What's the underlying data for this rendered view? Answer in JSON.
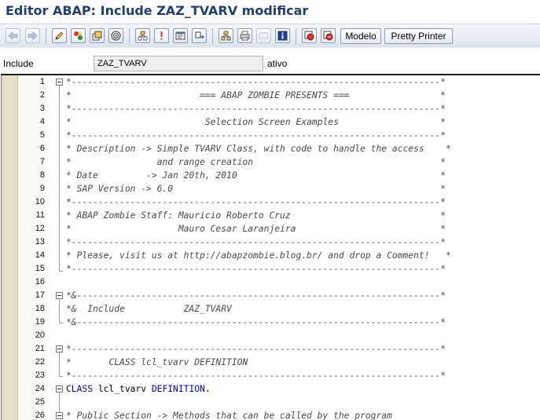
{
  "window": {
    "title": "Editor ABAP: Include ZAZ_TVARV modificar"
  },
  "toolbar": {
    "icons": [
      "back-arrow-icon",
      "forward-arrow-icon",
      "edit-pencil-icon",
      "toggle-display-icon",
      "other-object-icon",
      "activate-icon",
      "where-used-icon",
      "navigate-icon",
      "display-object-list-icon",
      "enhancement-icon",
      "pattern-icon",
      "pretty-printer-icon",
      "disabled-icon",
      "info-icon",
      "breakpoint-icon",
      "session-breakpoint-icon"
    ],
    "modelo_label": "Modelo",
    "pretty_printer_label": "Pretty Printer"
  },
  "info": {
    "include_label": "Include",
    "include_value": "ZAZ_TVARV",
    "status": "ativo"
  },
  "colors": {
    "title": "#1f3f73",
    "keyword": "#0000cc",
    "comment": "#4a4a4a"
  },
  "editor": {
    "lines": [
      {
        "num": "1",
        "kind": "comment",
        "text": "*---------------------------------------------------------------------*"
      },
      {
        "num": "2",
        "kind": "comment",
        "text": "*                        === ABAP ZOMBIE PRESENTS ===                 *"
      },
      {
        "num": "3",
        "kind": "comment",
        "text": "*---------------------------------------------------------------------*"
      },
      {
        "num": "4",
        "kind": "comment",
        "text": "*                         Selection Screen Examples                   *"
      },
      {
        "num": "5",
        "kind": "comment",
        "text": "*---------------------------------------------------------------------*"
      },
      {
        "num": "6",
        "kind": "comment",
        "text": "* Description -> Simple TVARV Class, with code to handle the access    *"
      },
      {
        "num": "7",
        "kind": "comment",
        "text": "*                and range creation                                   *"
      },
      {
        "num": "8",
        "kind": "comment",
        "text": "* Date         -> Jan 20th, 2010                                      *"
      },
      {
        "num": "9",
        "kind": "comment",
        "text": "* SAP Version -> 6.0                                                  *"
      },
      {
        "num": "10",
        "kind": "comment",
        "text": "*---------------------------------------------------------------------*"
      },
      {
        "num": "11",
        "kind": "comment",
        "text": "* ABAP Zombie Staff: Mauricio Roberto Cruz                            *"
      },
      {
        "num": "12",
        "kind": "comment",
        "text": "*                    Mauro Cesar Laranjeira                           *"
      },
      {
        "num": "13",
        "kind": "comment",
        "text": "*---------------------------------------------------------------------*"
      },
      {
        "num": "14",
        "kind": "comment",
        "text": "* Please, visit us at http://abapzombie.blog.br/ and drop a Comment!   *"
      },
      {
        "num": "15",
        "kind": "comment",
        "text": "*---------------------------------------------------------------------*"
      },
      {
        "num": "16",
        "kind": "blank",
        "text": ""
      },
      {
        "num": "17",
        "kind": "comment",
        "text": "*&--------------------------------------------------------------------*"
      },
      {
        "num": "18",
        "kind": "comment",
        "text": "*&  Include           ZAZ_TVARV"
      },
      {
        "num": "19",
        "kind": "comment",
        "text": "*&--------------------------------------------------------------------*"
      },
      {
        "num": "20",
        "kind": "blank",
        "text": ""
      },
      {
        "num": "21",
        "kind": "comment",
        "text": "*---------------------------------------------------------------------*"
      },
      {
        "num": "22",
        "kind": "comment",
        "text": "*       CLASS lcl_tvarv DEFINITION"
      },
      {
        "num": "23",
        "kind": "comment",
        "text": "*---------------------------------------------------------------------*"
      },
      {
        "num": "24",
        "kind": "stmt",
        "text": "",
        "parts": [
          "CLASS",
          " lcl_tvarv ",
          "DEFINITION."
        ]
      },
      {
        "num": "25",
        "kind": "blank",
        "text": ""
      },
      {
        "num": "26",
        "kind": "comment",
        "text": "* Public Section -> Methods that can be called by the program"
      }
    ]
  }
}
